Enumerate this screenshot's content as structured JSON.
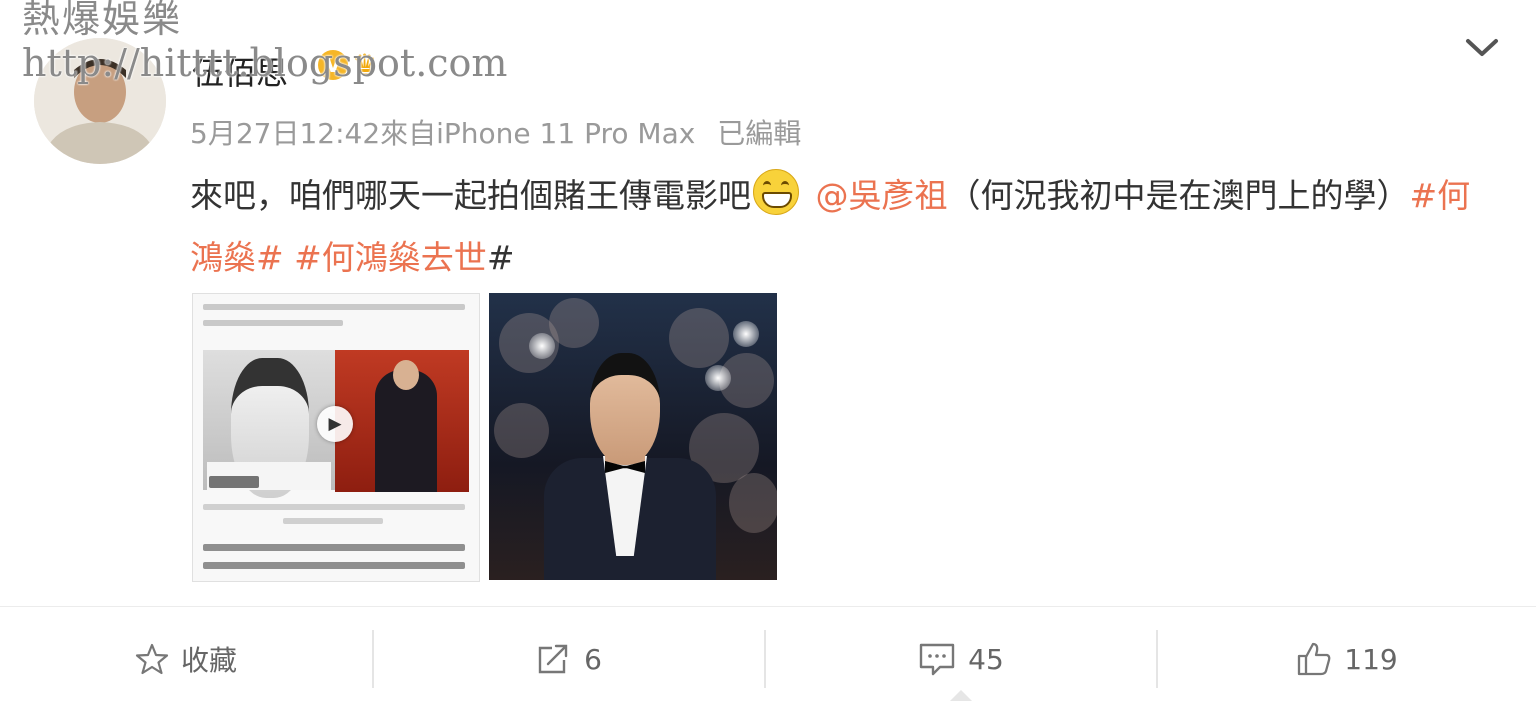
{
  "watermark": {
    "line1": "熱爆娛樂",
    "line2": "http://hitttt.blogspot.com"
  },
  "post": {
    "username": "伍佰思",
    "badge_v": "V",
    "timestamp": "5月27日12:42",
    "source": "來自iPhone 11 Pro Max",
    "edited": "已編輯",
    "text_part1": "來吧，咱們哪天一起拍個賭王傳電影吧",
    "emoji": "grinning-face-icon",
    "mention": "@吳彥祖",
    "text_part2": "（何況我初中是在澳門上的學）",
    "hashtag1": "#何鴻燊#",
    "hashtag2": "#何鴻燊去世",
    "hashtag2_end": "#"
  },
  "actions": {
    "favorite_label": "收藏",
    "share_count": "6",
    "comment_count": "45",
    "like_count": "119"
  },
  "colors": {
    "link": "#eb7350",
    "meta": "#9a9a9a",
    "text": "#333333",
    "vip": "#f6b627"
  }
}
